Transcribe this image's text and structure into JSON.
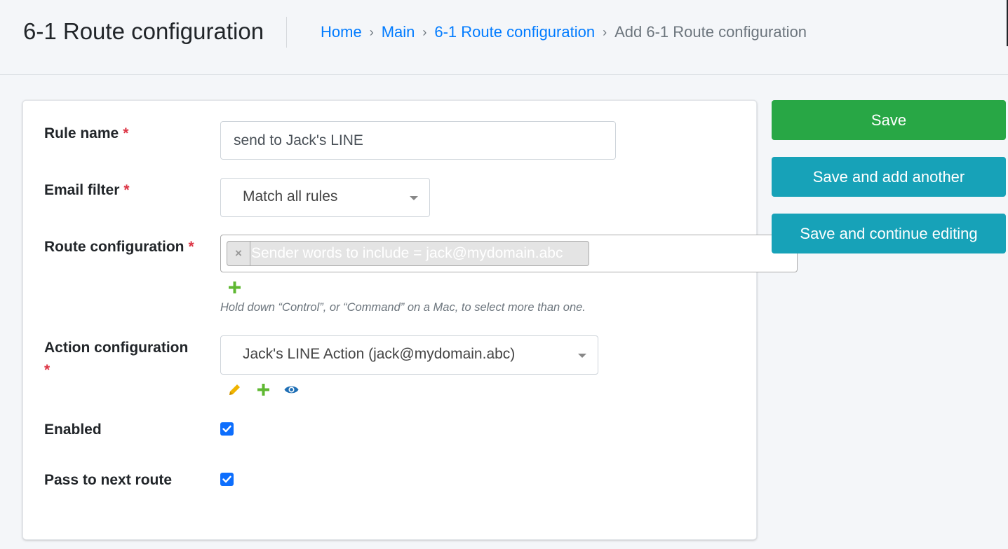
{
  "header": {
    "title": "6-1 Route configuration",
    "breadcrumb": {
      "home": "Home",
      "main": "Main",
      "section": "6-1 Route configuration",
      "current": "Add 6-1 Route configuration",
      "separator": "›"
    }
  },
  "form": {
    "rule_name": {
      "label": "Rule name",
      "required": "*",
      "value": "send to Jack's LINE"
    },
    "email_filter": {
      "label": "Email filter",
      "required": "*",
      "value": "Match all rules"
    },
    "route_configuration": {
      "label": "Route configuration",
      "required": "*",
      "selected_tags": [
        {
          "remove": "×",
          "text": "Sender words to include = jack@mydomain.abc"
        }
      ],
      "help_text": "Hold down “Control”, or “Command” on a Mac, to select more than one."
    },
    "action_configuration": {
      "label": "Action configuration",
      "required": "*",
      "value": "Jack's LINE Action (jack@mydomain.abc)"
    },
    "enabled": {
      "label": "Enabled",
      "checked": true
    },
    "pass_to_next_route": {
      "label": "Pass to next route",
      "checked": true
    }
  },
  "actions": {
    "save": "Save",
    "save_add_another": "Save and add another",
    "save_continue": "Save and continue editing"
  },
  "icons": {
    "add_related": "plus-icon",
    "change_related": "pencil-icon",
    "view_related": "eye-icon"
  },
  "colors": {
    "link": "#007bff",
    "required": "#dc3545",
    "save": "#28a745",
    "secondary_buttons": "#17a2b8",
    "checkbox": "#0d6efd",
    "plus": "#5fb832",
    "pencil": "#f0b400",
    "eye": "#1f6fb5"
  }
}
